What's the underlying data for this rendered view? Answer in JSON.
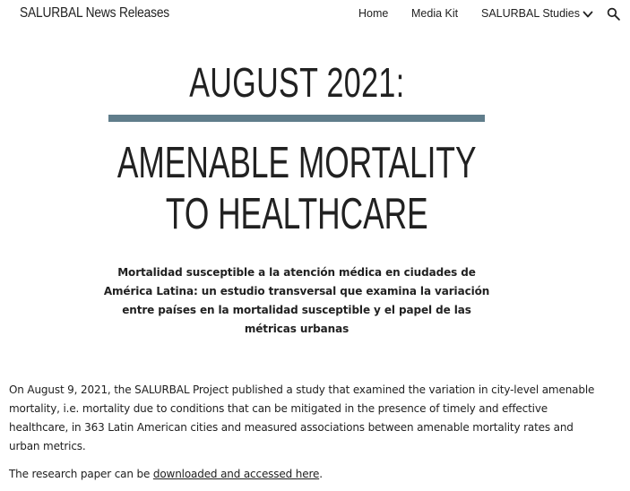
{
  "header": {
    "site_title": "SALURBAL News Releases",
    "nav": {
      "home": "Home",
      "media_kit": "Media Kit",
      "studies": "SALURBAL Studies"
    },
    "icons": {
      "dropdown": "chevron-down-icon",
      "search": "search-icon"
    }
  },
  "main": {
    "date_heading": "AUGUST 2021:",
    "rule_color": "#607d8b",
    "title_line1": "AMENABLE MORTALITY",
    "title_line2": "TO HEALTHCARE",
    "subtitle": "Mortalidad susceptible a la atención médica en ciudades de América Latina: un estudio transversal que examina la variación entre países en la mortalidad susceptible y el papel de las métricas urbanas",
    "paragraph1": "On August 9, 2021, the SALURBAL Project published a study that examined the variation in city-level amenable mortality, i.e. mortality due to conditions that can be mitigated in the presence of timely and effective healthcare, in 363 Latin American cities and measured associations between amenable mortality rates and urban metrics.",
    "paragraph2_prefix": "The research paper can be ",
    "paragraph2_link": "downloaded and accessed here",
    "paragraph2_suffix": "."
  }
}
